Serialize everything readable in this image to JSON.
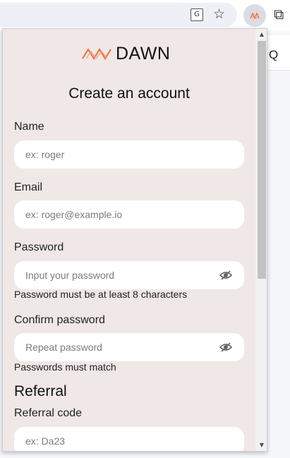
{
  "browser": {
    "translate_icon_glyph": "G",
    "star_glyph": "☆",
    "extension_logo_color": "#f26b3a",
    "puzzle_glyph": "⧉",
    "page_partial_text": "Q"
  },
  "popup": {
    "brand": "DAWN",
    "brand_color": "#f26b3a",
    "title": "Create an account",
    "fields": {
      "name": {
        "label": "Name",
        "placeholder": "ex: roger"
      },
      "email": {
        "label": "Email",
        "placeholder": "ex: roger@example.io"
      },
      "password": {
        "label": "Password",
        "placeholder": "Input your password",
        "hint": "Password must be at least 8 characters"
      },
      "confirm": {
        "label": "Confirm password",
        "placeholder": "Repeat password",
        "hint": "Passwords must match"
      }
    },
    "referral": {
      "section_title": "Referral",
      "label": "Referral code",
      "placeholder": "ex: Da23"
    },
    "scroll": {
      "up": "▲",
      "down": "▼"
    }
  }
}
